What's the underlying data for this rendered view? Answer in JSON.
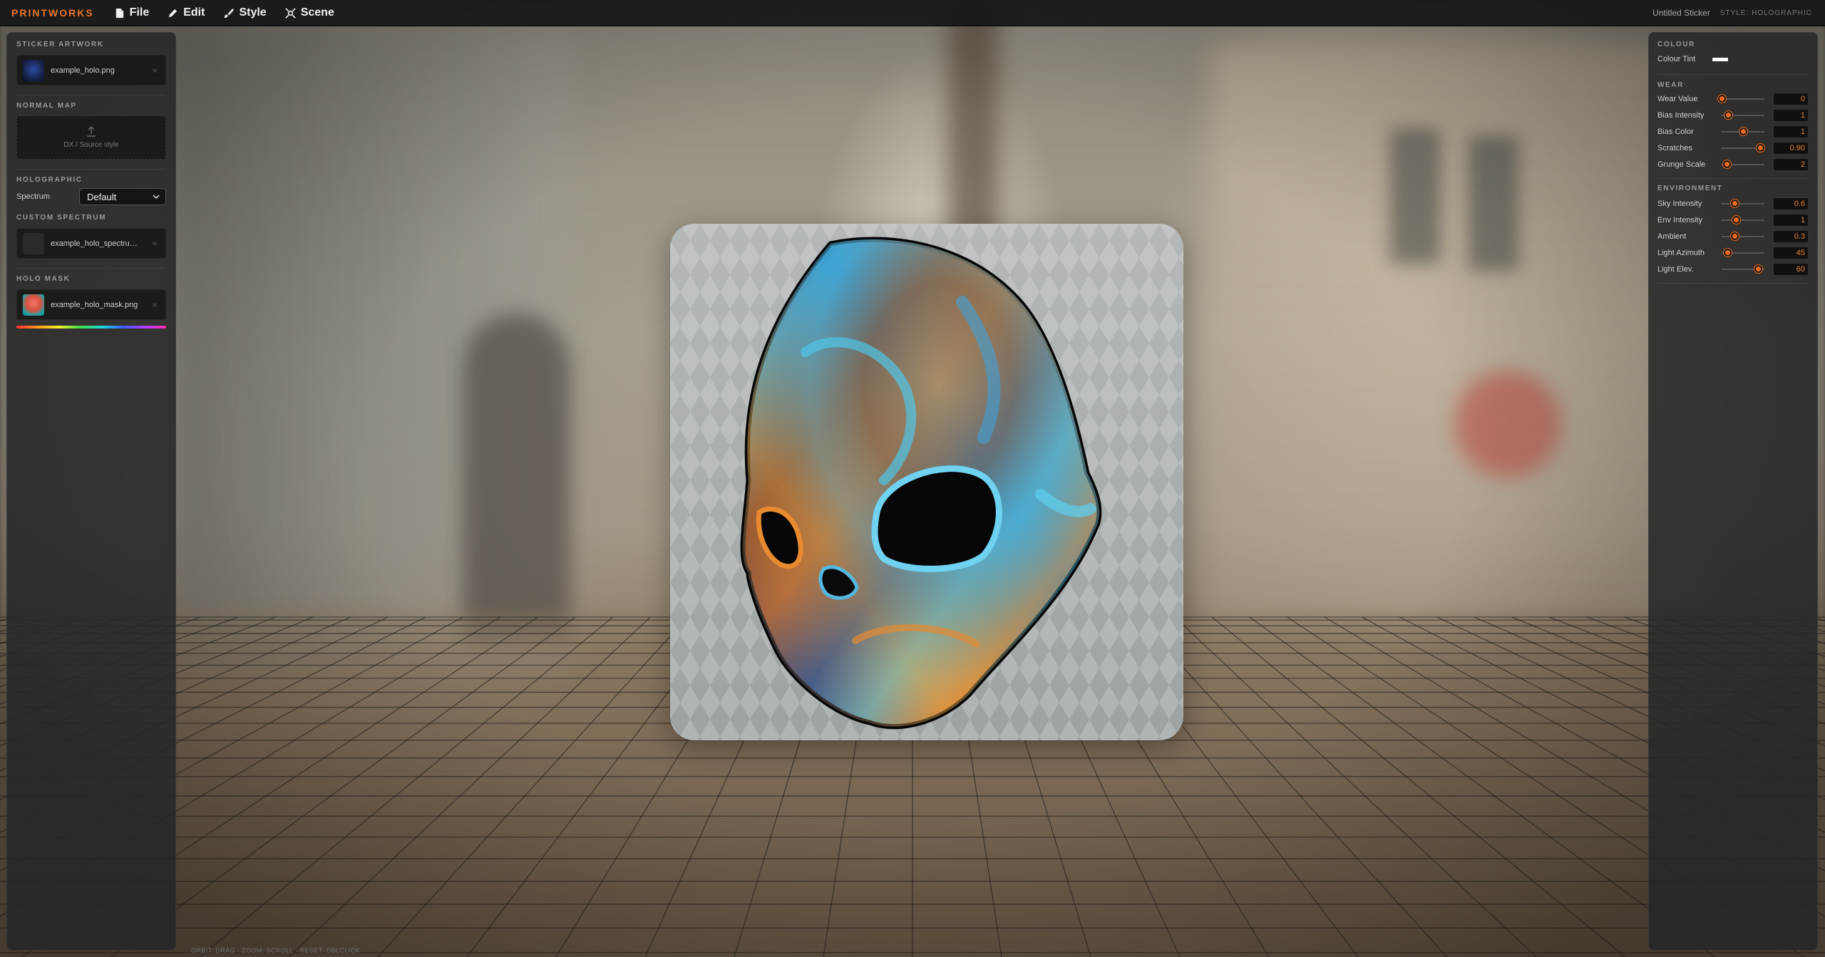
{
  "app": {
    "brand": "PRINTWORKS",
    "menu": [
      {
        "label": "File",
        "icon": "file-icon"
      },
      {
        "label": "Edit",
        "icon": "pencil-icon"
      },
      {
        "label": "Style",
        "icon": "brush-icon"
      },
      {
        "label": "Scene",
        "icon": "scene-icon"
      }
    ],
    "doc_title": "Untitled Sticker",
    "style_tag": "STYLE: HOLOGRAPHIC",
    "accent_color": "#e8762b"
  },
  "left_panel": {
    "sticker_artwork": {
      "title": "STICKER ARTWORK",
      "file": "example_holo.png",
      "remove": "×"
    },
    "normal_map": {
      "title": "NORMAL MAP",
      "placeholder": "DX / Source style",
      "icon": "upload-icon"
    },
    "holographic": {
      "title": "HOLOGRAPHIC",
      "spectrum_label": "Spectrum",
      "spectrum_value": "Default"
    },
    "custom_spectrum": {
      "title": "CUSTOM SPECTRUM",
      "file": "example_holo_spectrum....",
      "remove": "×"
    },
    "holo_mask": {
      "title": "HOLO MASK",
      "file": "example_holo_mask.png",
      "remove": "×"
    }
  },
  "right_panel": {
    "colour": {
      "title": "COLOUR",
      "tint_label": "Colour Tint",
      "tint_color": "#ffffff"
    },
    "wear": {
      "title": "WEAR",
      "sliders": [
        {
          "label": "Wear Value",
          "value": "0",
          "fraction": 0.0
        },
        {
          "label": "Bias Intensity",
          "value": "1",
          "fraction": 0.15
        },
        {
          "label": "Bias Color",
          "value": "1",
          "fraction": 0.5
        },
        {
          "label": "Scratches",
          "value": "0.90",
          "fraction": 0.9
        },
        {
          "label": "Grunge Scale",
          "value": "2",
          "fraction": 0.12
        }
      ]
    },
    "environment": {
      "title": "ENVIRONMENT",
      "sliders": [
        {
          "label": "Sky Intensity",
          "value": "0.6",
          "fraction": 0.3
        },
        {
          "label": "Env Intensity",
          "value": "1",
          "fraction": 0.33
        },
        {
          "label": "Ambient",
          "value": "0.3",
          "fraction": 0.3
        },
        {
          "label": "Light Azimuth",
          "value": "45",
          "fraction": 0.125
        },
        {
          "label": "Light Elev.",
          "value": "60",
          "fraction": 0.85
        }
      ]
    }
  },
  "viewport": {
    "hint": "ORBIT: DRAG · ZOOM: SCROLL · RESET: DBLCLICK"
  }
}
